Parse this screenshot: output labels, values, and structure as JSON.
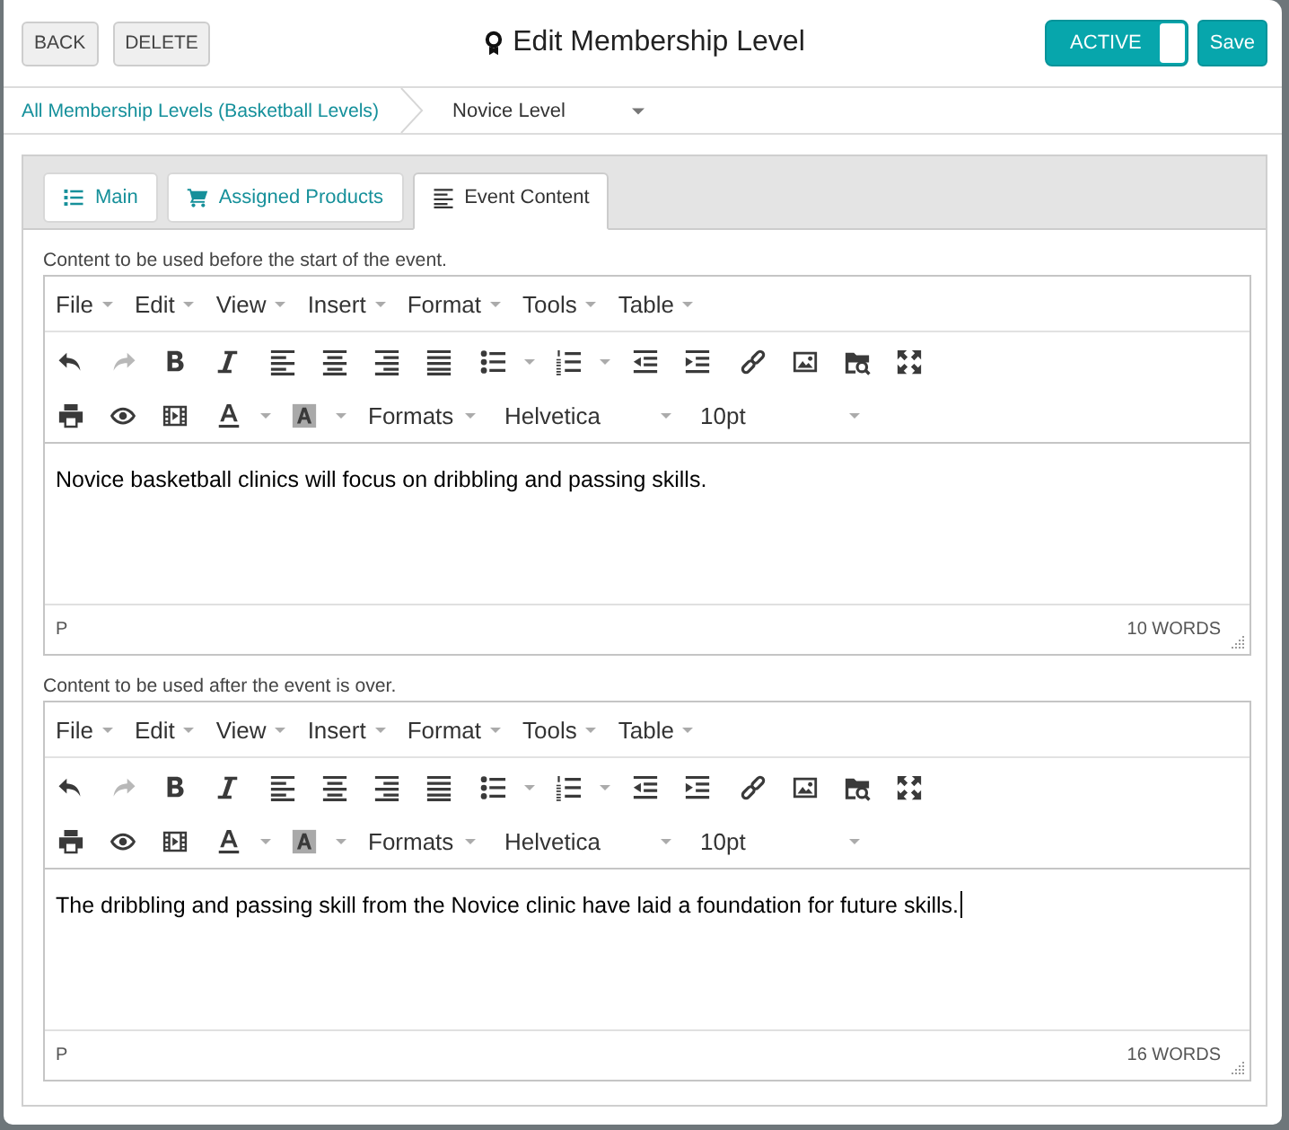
{
  "window": {
    "title": "Edit Membership Level"
  },
  "header": {
    "actions": [
      "BACK",
      "DELETE"
    ],
    "status_toggle": {
      "label": "ACTIVE",
      "on": true
    },
    "save": "Save"
  },
  "breadcrumb": [
    {
      "label": "All Membership Levels (Basketball Levels)",
      "kind": "link"
    },
    {
      "label": "Novice Level",
      "kind": "dropdown"
    }
  ],
  "tabs": [
    {
      "label": "Main",
      "selected": false
    },
    {
      "label": "Assigned Products",
      "selected": false
    },
    {
      "label": "Event Content",
      "selected": true
    }
  ],
  "editors": [
    {
      "label": "Content to be used before the start of the event.",
      "menu": [
        "File",
        "Edit",
        "View",
        "Insert",
        "Format",
        "Tools",
        "Table"
      ],
      "undo_disabled": false,
      "redo_disabled": true,
      "formats": "Formats",
      "font": "Helvetica",
      "font_size": "10pt",
      "content": "Novice basketball clinics will focus on dribbling and passing skills.",
      "cursor": false,
      "path": "P",
      "word_count": "10 WORDS"
    },
    {
      "label": "Content to be used after the event is over.",
      "menu": [
        "File",
        "Edit",
        "View",
        "Insert",
        "Format",
        "Tools",
        "Table"
      ],
      "undo_disabled": false,
      "redo_disabled": true,
      "formats": "Formats",
      "font": "Helvetica",
      "font_size": "10pt",
      "content": "The dribbling and passing skill from the Novice clinic have laid a foundation for future skills.",
      "cursor": true,
      "path": "P",
      "word_count": "16 WORDS"
    }
  ]
}
